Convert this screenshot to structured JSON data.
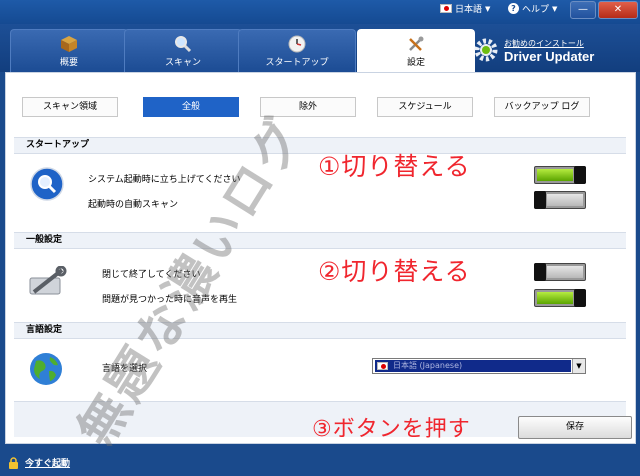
{
  "titlebar": {
    "language_label": "日本語",
    "help_label": "ヘルプ",
    "minimize_label": "—",
    "close_label": "✕"
  },
  "tabs": [
    {
      "label": "概要",
      "icon": "box-icon"
    },
    {
      "label": "スキャン",
      "icon": "magnifier-icon"
    },
    {
      "label": "スタートアップ",
      "icon": "clock-icon"
    },
    {
      "label": "設定",
      "icon": "tools-icon",
      "active": true
    }
  ],
  "brand": {
    "subtitle": "お勧めのインストール",
    "name": "Driver Updater"
  },
  "subtabs": [
    {
      "label": "スキャン領域"
    },
    {
      "label": "全般",
      "active": true
    },
    {
      "label": "除外"
    },
    {
      "label": "スケジュール"
    },
    {
      "label": "バックアップ ログ"
    }
  ],
  "sections": {
    "startup": {
      "title": "スタートアップ",
      "options": [
        {
          "label": "システム起動時に立ち上げてください",
          "enabled": true
        },
        {
          "label": "起動時の自動スキャン",
          "enabled": false
        }
      ]
    },
    "general": {
      "title": "一般設定",
      "options": [
        {
          "label": "閉じて終了してください",
          "enabled": false
        },
        {
          "label": "問題が見つかった時に音声を再生",
          "enabled": true
        }
      ]
    },
    "language": {
      "title": "言語設定",
      "select_label": "言語を選択",
      "selected_value": "日本語 (Japanese)"
    }
  },
  "save_button": "保存",
  "annotations": {
    "step1": "①切り替える",
    "step2": "②切り替える",
    "step3": "③ボタンを押す",
    "watermark": "無題な濃いログ"
  },
  "footer": {
    "launch_label": "今すぐ起動"
  },
  "colors": {
    "accent_blue": "#1f63c7",
    "frame_blue": "#1a4a8c",
    "toggle_on": "#6ebd10",
    "annotation_red": "#f0262e"
  }
}
